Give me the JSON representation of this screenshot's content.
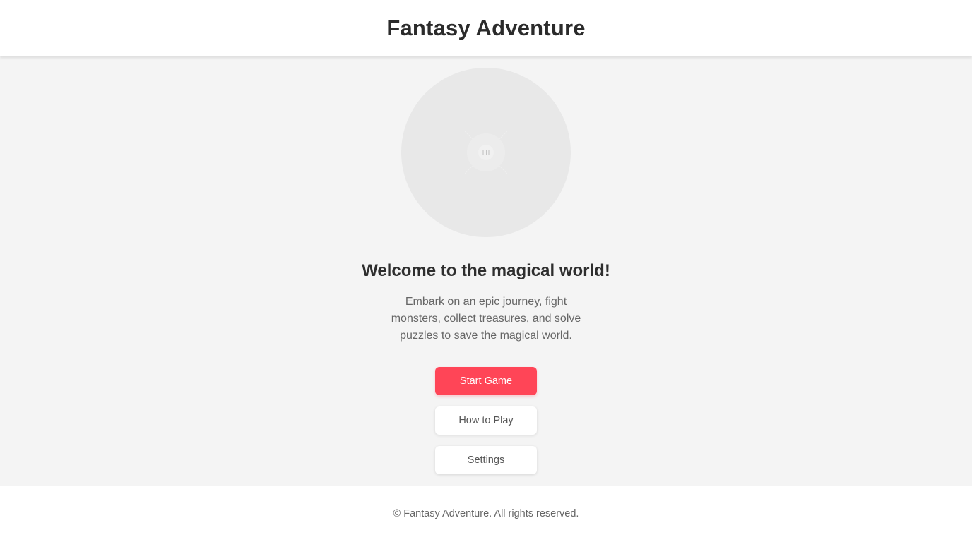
{
  "header": {
    "title": "Fantasy Adventure"
  },
  "hero": {
    "icon": "broken-image-icon"
  },
  "main": {
    "welcome_title": "Welcome to the magical world!",
    "description": "Embark on an epic journey, fight monsters, collect treasures, and solve puzzles to save the magical world."
  },
  "buttons": {
    "start_label": "Start Game",
    "howto_label": "How to Play",
    "settings_label": "Settings"
  },
  "footer": {
    "copyright": "© Fantasy Adventure. All rights reserved."
  },
  "colors": {
    "accent": "#ff4557",
    "background": "#f4f4f4",
    "surface": "#ffffff"
  }
}
